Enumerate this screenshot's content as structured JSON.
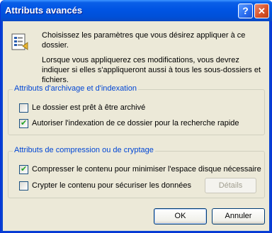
{
  "window": {
    "title": "Attributs avancés"
  },
  "title_buttons": {
    "help": "?",
    "close": "✕"
  },
  "intro": {
    "line1": "Choisissez les paramètres que vous désirez appliquer à ce dossier.",
    "line2": "Lorsque vous appliquerez ces modifications, vous devrez indiquer si elles s'appliqueront aussi à tous les sous-dossiers et fichiers."
  },
  "archive_group": {
    "legend": "Attributs d'archivage et d'indexation",
    "options": [
      {
        "label": "Le dossier est prêt à être archivé",
        "checked": false
      },
      {
        "label": "Autoriser l'indexation de ce dossier pour la recherche rapide",
        "checked": true
      }
    ]
  },
  "compress_group": {
    "legend": "Attributs de compression ou de cryptage",
    "options": [
      {
        "label": "Compresser le contenu pour minimiser l'espace disque nécessaire",
        "checked": true
      },
      {
        "label": "Crypter le contenu pour sécuriser les données",
        "checked": false
      }
    ],
    "details_label": "Détails"
  },
  "buttons": {
    "ok": "OK",
    "cancel": "Annuler"
  },
  "icons": {
    "folder_options": "folder-options-icon"
  }
}
